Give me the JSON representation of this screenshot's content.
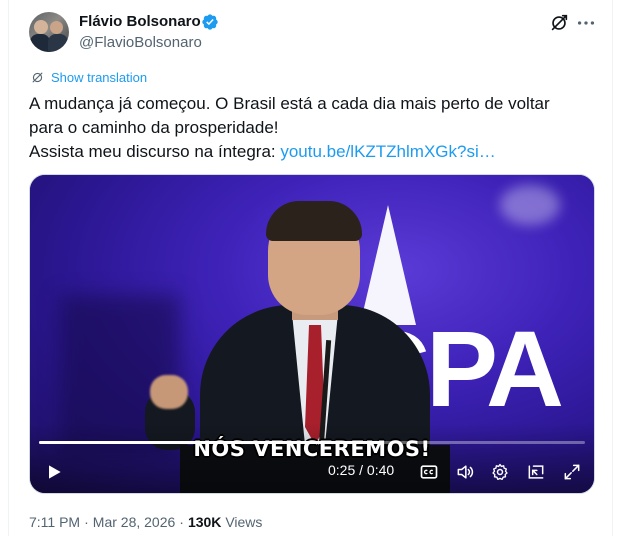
{
  "author": {
    "display_name": "Flávio Bolsonaro",
    "handle": "@FlavioBolsonaro",
    "verified": true
  },
  "header_actions": {
    "grok_icon": "grok-icon",
    "more_icon": "more-icon"
  },
  "translation": {
    "label": "Show translation",
    "icon": "translate-icon"
  },
  "tweet": {
    "line1": "A mudança já começou. O Brasil está a cada dia mais perto de voltar",
    "line2": "para o caminho da prosperidade!",
    "line3_prefix": "Assista meu discurso na íntegra: ",
    "link_text": "youtu.be/lKZTZhlmXGk?si…"
  },
  "video": {
    "caption": "NÓS VENCEREMOS!",
    "backdrop_text": "CPA",
    "current_time": "0:25",
    "duration": "0:40",
    "time_display": "0:25 / 0:40",
    "progress": 0.625,
    "controls": [
      "play-icon",
      "captions-icon",
      "volume-icon",
      "settings-icon",
      "pip-icon",
      "fullscreen-icon"
    ]
  },
  "meta": {
    "time": "7:11 PM",
    "date": "Mar 28, 2026",
    "views_count": "130K",
    "views_label": "Views"
  },
  "colors": {
    "accent": "#1d9bf0",
    "text_primary": "#0f1419",
    "text_secondary": "#536471",
    "verified": "#1d9bf0"
  }
}
